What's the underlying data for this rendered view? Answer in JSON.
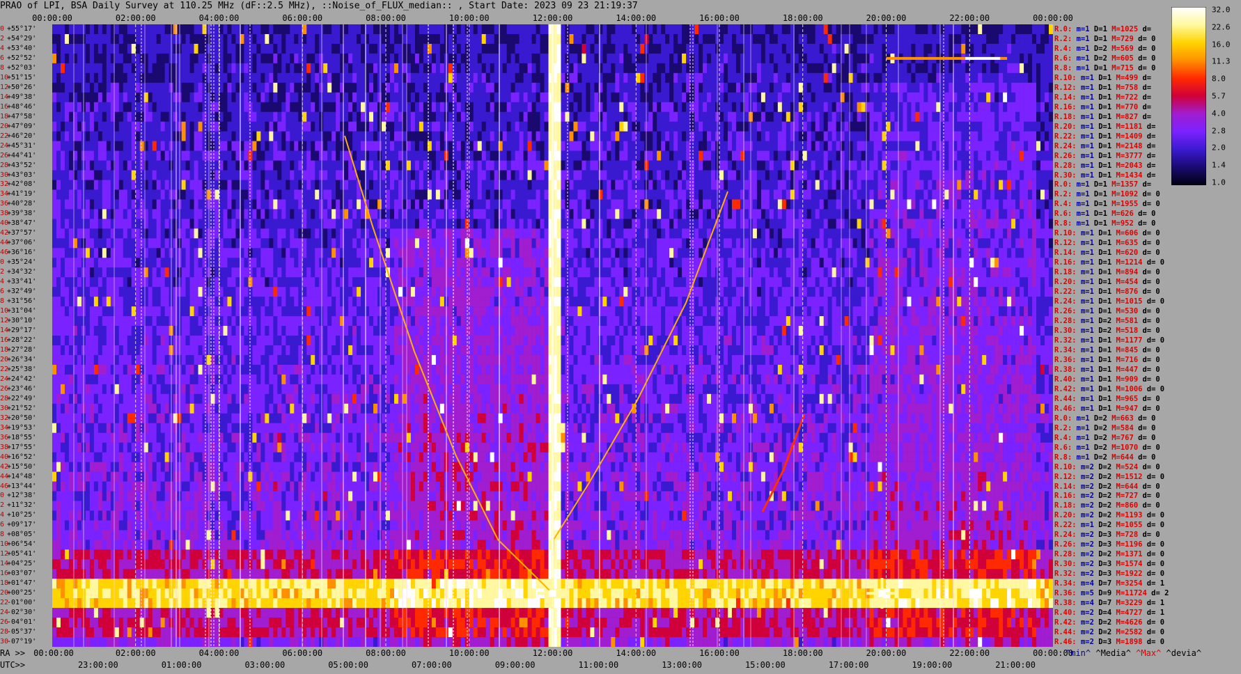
{
  "header": {
    "title": "PRAO of LPI, BSA Daily Survey at 110.25 MHz (dF::2.5 MHz), ::Noise_of_FLUX_median:: , Start Date: 2023 09 23 21:19:37"
  },
  "top_axis": [
    "00:00:00",
    "02:00:00",
    "04:00:00",
    "06:00:00",
    "08:00:00",
    "10:00:00",
    "12:00:00",
    "14:00:00",
    "16:00:00",
    "18:00:00",
    "20:00:00",
    "22:00:00",
    "00:00:00"
  ],
  "bottom_axis": {
    "ra_label": "RA >>",
    "utc_label": "UTC>>",
    "ra_ticks": [
      "00:00:00",
      "02:00:00",
      "04:00:00",
      "06:00:00",
      "08:00:00",
      "10:00:00",
      "12:00:00",
      "14:00:00",
      "16:00:00",
      "18:00:00",
      "20:00:00",
      "22:00:00",
      "00:00:00"
    ],
    "utc_ticks": [
      "23:00:00",
      "01:00:00",
      "03:00:00",
      "05:00:00",
      "07:00:00",
      "09:00:00",
      "11:00:00",
      "13:00:00",
      "15:00:00",
      "17:00:00",
      "19:00:00",
      "21:00:00"
    ]
  },
  "stat_legend": {
    "min": "^min^",
    "median": "^Media^",
    "max": "^Max^",
    "dev": "^devia^"
  },
  "colorbar": {
    "labels": [
      "32.0",
      "22.6",
      "16.0",
      "11.3",
      "8.0",
      "5.7",
      "4.0",
      "2.8",
      "2.0",
      "1.4",
      "1.0"
    ],
    "gradient": [
      "#ffffff",
      "#fff8a0",
      "#ffd400",
      "#ff9000",
      "#ff2a00",
      "#d0003a",
      "#a01dd0",
      "#7a22ff",
      "#3a1ad0",
      "#1a0a70",
      "#000010"
    ]
  },
  "declinations": [
    {
      "row": "0",
      "dec": "+55°17'"
    },
    {
      "row": "2",
      "dec": "+54°29'"
    },
    {
      "row": "4",
      "dec": "+53°40'"
    },
    {
      "row": "6",
      "dec": "+52°52'"
    },
    {
      "row": "8",
      "dec": "+52°03'"
    },
    {
      "row": "10",
      "dec": "+51°15'"
    },
    {
      "row": "12",
      "dec": "+50°26'"
    },
    {
      "row": "14",
      "dec": "+49°38'"
    },
    {
      "row": "16",
      "dec": "+48°46'"
    },
    {
      "row": "18",
      "dec": "+47°58'"
    },
    {
      "row": "20",
      "dec": "+47°09'"
    },
    {
      "row": "22",
      "dec": "+46°20'"
    },
    {
      "row": "24",
      "dec": "+45°31'"
    },
    {
      "row": "26",
      "dec": "+44°41'"
    },
    {
      "row": "28",
      "dec": "+43°52'"
    },
    {
      "row": "30",
      "dec": "+43°03'"
    },
    {
      "row": "32",
      "dec": "+42°08'"
    },
    {
      "row": "34",
      "dec": "+41°19'"
    },
    {
      "row": "36",
      "dec": "+40°28'"
    },
    {
      "row": "38",
      "dec": "+39°38'"
    },
    {
      "row": "40",
      "dec": "+38°47'"
    },
    {
      "row": "42",
      "dec": "+37°57'"
    },
    {
      "row": "44",
      "dec": "+37°06'"
    },
    {
      "row": "46",
      "dec": "+36°16'"
    },
    {
      "row": "0",
      "dec": "+35°24'"
    },
    {
      "row": "2",
      "dec": "+34°32'"
    },
    {
      "row": "4",
      "dec": "+33°41'"
    },
    {
      "row": "6",
      "dec": "+32°49'"
    },
    {
      "row": "8",
      "dec": "+31°56'"
    },
    {
      "row": "10",
      "dec": "+31°04'"
    },
    {
      "row": "12",
      "dec": "+30°10'"
    },
    {
      "row": "14",
      "dec": "+29°17'"
    },
    {
      "row": "16",
      "dec": "+28°22'"
    },
    {
      "row": "18",
      "dec": "+27°28'"
    },
    {
      "row": "20",
      "dec": "+26°34'"
    },
    {
      "row": "22",
      "dec": "+25°38'"
    },
    {
      "row": "24",
      "dec": "+24°42'"
    },
    {
      "row": "26",
      "dec": "+23°46'"
    },
    {
      "row": "28",
      "dec": "+22°49'"
    },
    {
      "row": "30",
      "dec": "+21°52'"
    },
    {
      "row": "32",
      "dec": "+20°50'"
    },
    {
      "row": "34",
      "dec": "+19°53'"
    },
    {
      "row": "36",
      "dec": "+18°55'"
    },
    {
      "row": "38",
      "dec": "+17°55'"
    },
    {
      "row": "40",
      "dec": "+16°52'"
    },
    {
      "row": "42",
      "dec": "+15°50'"
    },
    {
      "row": "44",
      "dec": "+14°48'"
    },
    {
      "row": "46",
      "dec": "+13°44'"
    },
    {
      "row": "0",
      "dec": "+12°38'"
    },
    {
      "row": "2",
      "dec": "+11°32'"
    },
    {
      "row": "4",
      "dec": "+10°25'"
    },
    {
      "row": "6",
      "dec": "+09°17'"
    },
    {
      "row": "8",
      "dec": "+08°05'"
    },
    {
      "row": "10",
      "dec": "+06°54'"
    },
    {
      "row": "12",
      "dec": "+05°41'"
    },
    {
      "row": "14",
      "dec": "+04°25'"
    },
    {
      "row": "16",
      "dec": "+03°07'"
    },
    {
      "row": "18",
      "dec": "+01°47'"
    },
    {
      "row": "20",
      "dec": "+00°25'"
    },
    {
      "row": "22",
      "dec": "-01°00'"
    },
    {
      "row": "24",
      "dec": "-02°30'"
    },
    {
      "row": "26",
      "dec": "-04°01'"
    },
    {
      "row": "28",
      "dec": "-05°37'"
    },
    {
      "row": "30",
      "dec": "-07°19'"
    }
  ],
  "right_stats": [
    {
      "r": "R.0:",
      "m": "m=1",
      "d": "D=1",
      "M": "M=1025",
      "dv": "d="
    },
    {
      "r": "R.2:",
      "m": "m=1",
      "d": "D=1",
      "M": "M=729",
      "dv": "d= 0"
    },
    {
      "r": "R.4:",
      "m": "m=1",
      "d": "D=2",
      "M": "M=569",
      "dv": "d= 0"
    },
    {
      "r": "R.6:",
      "m": "m=1",
      "d": "D=2",
      "M": "M=605",
      "dv": "d= 0"
    },
    {
      "r": "R.8:",
      "m": "m=1",
      "d": "D=1",
      "M": "M=715",
      "dv": "d= 0"
    },
    {
      "r": "R.10:",
      "m": "m=1",
      "d": "D=1",
      "M": "M=499",
      "dv": "d="
    },
    {
      "r": "R.12:",
      "m": "m=1",
      "d": "D=1",
      "M": "M=758",
      "dv": "d="
    },
    {
      "r": "R.14:",
      "m": "m=1",
      "d": "D=1",
      "M": "M=722",
      "dv": "d="
    },
    {
      "r": "R.16:",
      "m": "m=1",
      "d": "D=1",
      "M": "M=770",
      "dv": "d="
    },
    {
      "r": "R.18:",
      "m": "m=1",
      "d": "D=1",
      "M": "M=827",
      "dv": "d="
    },
    {
      "r": "R.20:",
      "m": "m=1",
      "d": "D=1",
      "M": "M=1181",
      "dv": "d="
    },
    {
      "r": "R.22:",
      "m": "m=1",
      "d": "D=1",
      "M": "M=1409",
      "dv": "d="
    },
    {
      "r": "R.24:",
      "m": "m=1",
      "d": "D=1",
      "M": "M=2148",
      "dv": "d="
    },
    {
      "r": "R.26:",
      "m": "m=1",
      "d": "D=1",
      "M": "M=3777",
      "dv": "d="
    },
    {
      "r": "R.28:",
      "m": "m=1",
      "d": "D=1",
      "M": "M=2043",
      "dv": "d="
    },
    {
      "r": "R.30:",
      "m": "m=1",
      "d": "D=1",
      "M": "M=1434",
      "dv": "d="
    },
    {
      "r": "R.0:",
      "m": "m=1",
      "d": "D=1",
      "M": "M=1357",
      "dv": "d="
    },
    {
      "r": "R.2:",
      "m": "m=1",
      "d": "D=1",
      "M": "M=1092",
      "dv": "d= 0"
    },
    {
      "r": "R.4:",
      "m": "m=1",
      "d": "D=1",
      "M": "M=1955",
      "dv": "d= 0"
    },
    {
      "r": "R.6:",
      "m": "m=1",
      "d": "D=1",
      "M": "M=626",
      "dv": "d= 0"
    },
    {
      "r": "R.8:",
      "m": "m=1",
      "d": "D=1",
      "M": "M=952",
      "dv": "d= 0"
    },
    {
      "r": "R.10:",
      "m": "m=1",
      "d": "D=1",
      "M": "M=606",
      "dv": "d= 0"
    },
    {
      "r": "R.12:",
      "m": "m=1",
      "d": "D=1",
      "M": "M=635",
      "dv": "d= 0"
    },
    {
      "r": "R.14:",
      "m": "m=1",
      "d": "D=1",
      "M": "M=620",
      "dv": "d= 0"
    },
    {
      "r": "R.16:",
      "m": "m=1",
      "d": "D=1",
      "M": "M=1214",
      "dv": "d= 0"
    },
    {
      "r": "R.18:",
      "m": "m=1",
      "d": "D=1",
      "M": "M=894",
      "dv": "d= 0"
    },
    {
      "r": "R.20:",
      "m": "m=1",
      "d": "D=1",
      "M": "M=454",
      "dv": "d= 0"
    },
    {
      "r": "R.22:",
      "m": "m=1",
      "d": "D=1",
      "M": "M=876",
      "dv": "d= 0"
    },
    {
      "r": "R.24:",
      "m": "m=1",
      "d": "D=1",
      "M": "M=1015",
      "dv": "d= 0"
    },
    {
      "r": "R.26:",
      "m": "m=1",
      "d": "D=1",
      "M": "M=530",
      "dv": "d= 0"
    },
    {
      "r": "R.28:",
      "m": "m=1",
      "d": "D=2",
      "M": "M=581",
      "dv": "d= 0"
    },
    {
      "r": "R.30:",
      "m": "m=1",
      "d": "D=2",
      "M": "M=518",
      "dv": "d= 0"
    },
    {
      "r": "R.32:",
      "m": "m=1",
      "d": "D=1",
      "M": "M=1177",
      "dv": "d= 0"
    },
    {
      "r": "R.34:",
      "m": "m=1",
      "d": "D=1",
      "M": "M=845",
      "dv": "d= 0"
    },
    {
      "r": "R.36:",
      "m": "m=1",
      "d": "D=1",
      "M": "M=716",
      "dv": "d= 0"
    },
    {
      "r": "R.38:",
      "m": "m=1",
      "d": "D=1",
      "M": "M=447",
      "dv": "d= 0"
    },
    {
      "r": "R.40:",
      "m": "m=1",
      "d": "D=1",
      "M": "M=909",
      "dv": "d= 0"
    },
    {
      "r": "R.42:",
      "m": "m=1",
      "d": "D=1",
      "M": "M=1006",
      "dv": "d= 0"
    },
    {
      "r": "R.44:",
      "m": "m=1",
      "d": "D=1",
      "M": "M=965",
      "dv": "d= 0"
    },
    {
      "r": "R.46:",
      "m": "m=1",
      "d": "D=1",
      "M": "M=947",
      "dv": "d= 0"
    },
    {
      "r": "R.0:",
      "m": "m=1",
      "d": "D=2",
      "M": "M=663",
      "dv": "d= 0"
    },
    {
      "r": "R.2:",
      "m": "m=1",
      "d": "D=2",
      "M": "M=584",
      "dv": "d= 0"
    },
    {
      "r": "R.4:",
      "m": "m=1",
      "d": "D=2",
      "M": "M=767",
      "dv": "d= 0"
    },
    {
      "r": "R.6:",
      "m": "m=1",
      "d": "D=2",
      "M": "M=1070",
      "dv": "d= 0"
    },
    {
      "r": "R.8:",
      "m": "m=1",
      "d": "D=2",
      "M": "M=644",
      "dv": "d= 0"
    },
    {
      "r": "R.10:",
      "m": "m=2",
      "d": "D=2",
      "M": "M=524",
      "dv": "d= 0"
    },
    {
      "r": "R.12:",
      "m": "m=2",
      "d": "D=2",
      "M": "M=1512",
      "dv": "d= 0"
    },
    {
      "r": "R.14:",
      "m": "m=2",
      "d": "D=2",
      "M": "M=644",
      "dv": "d= 0"
    },
    {
      "r": "R.16:",
      "m": "m=2",
      "d": "D=2",
      "M": "M=727",
      "dv": "d= 0"
    },
    {
      "r": "R.18:",
      "m": "m=2",
      "d": "D=2",
      "M": "M=860",
      "dv": "d= 0"
    },
    {
      "r": "R.20:",
      "m": "m=2",
      "d": "D=2",
      "M": "M=1193",
      "dv": "d= 0"
    },
    {
      "r": "R.22:",
      "m": "m=1",
      "d": "D=2",
      "M": "M=1055",
      "dv": "d= 0"
    },
    {
      "r": "R.24:",
      "m": "m=2",
      "d": "D=3",
      "M": "M=728",
      "dv": "d= 0"
    },
    {
      "r": "R.26:",
      "m": "m=2",
      "d": "D=3",
      "M": "M=1196",
      "dv": "d= 0"
    },
    {
      "r": "R.28:",
      "m": "m=2",
      "d": "D=2",
      "M": "M=1371",
      "dv": "d= 0"
    },
    {
      "r": "R.30:",
      "m": "m=2",
      "d": "D=3",
      "M": "M=1574",
      "dv": "d= 0"
    },
    {
      "r": "R.32:",
      "m": "m=2",
      "d": "D=3",
      "M": "M=1922",
      "dv": "d= 0"
    },
    {
      "r": "R.34:",
      "m": "m=4",
      "d": "D=7",
      "M": "M=3254",
      "dv": "d= 1"
    },
    {
      "r": "R.36:",
      "m": "m=5",
      "d": "D=9",
      "M": "M=11724",
      "dv": "d= 2"
    },
    {
      "r": "R.38:",
      "m": "m=4",
      "d": "D=7",
      "M": "M=3229",
      "dv": "d= 1"
    },
    {
      "r": "R.40:",
      "m": "m=2",
      "d": "D=4",
      "M": "M=4727",
      "dv": "d= 1"
    },
    {
      "r": "R.42:",
      "m": "m=2",
      "d": "D=2",
      "M": "M=4626",
      "dv": "d= 0"
    },
    {
      "r": "R.44:",
      "m": "m=2",
      "d": "D=2",
      "M": "M=2582",
      "dv": "d= 0"
    },
    {
      "r": "R.46:",
      "m": "m=2",
      "d": "D=3",
      "M": "M=1898",
      "dv": "d= 0"
    }
  ],
  "chart_data": {
    "type": "heatmap",
    "title": "PRAO of LPI, BSA Daily Survey at 110.25 MHz (dF::2.5 MHz), ::Noise_of_FLUX_median:: , Start Date: 2023 09 23 21:19:37",
    "x_axis": {
      "label": "RA",
      "range_hours": [
        0,
        24
      ],
      "ticks": [
        "00:00:00",
        "02:00:00",
        "04:00:00",
        "06:00:00",
        "08:00:00",
        "10:00:00",
        "12:00:00",
        "14:00:00",
        "16:00:00",
        "18:00:00",
        "20:00:00",
        "22:00:00",
        "00:00:00"
      ]
    },
    "y_axis": {
      "label": "",
      "top": "+55°17'",
      "bottom": "-07°19'",
      "rows": 64
    },
    "colorscale": {
      "min": 1.0,
      "max": 32.0,
      "scale": "log",
      "ticks": [
        32.0,
        22.6,
        16.0,
        11.3,
        8.0,
        5.7,
        4.0,
        2.8,
        2.0,
        1.4,
        1.0
      ]
    },
    "features": [
      {
        "type": "vertical-line",
        "ra_hour": 12.0,
        "level": 32.0
      },
      {
        "type": "horizontal-band",
        "dec_from": "+01°47'",
        "dec_to": "-01°00'",
        "level": 16.0
      },
      {
        "type": "point-source",
        "ra_hour": 19.9,
        "dec": "+40°50'",
        "level": 32.0
      },
      {
        "type": "point-source",
        "ra_hour": 12.0,
        "dec": "+00°25'",
        "level": 32.0
      },
      {
        "type": "horizontal-streak",
        "ra_from": 20.0,
        "ra_to": 22.9,
        "dec": "+52°52'",
        "level": 16.0
      }
    ],
    "grid": true
  }
}
